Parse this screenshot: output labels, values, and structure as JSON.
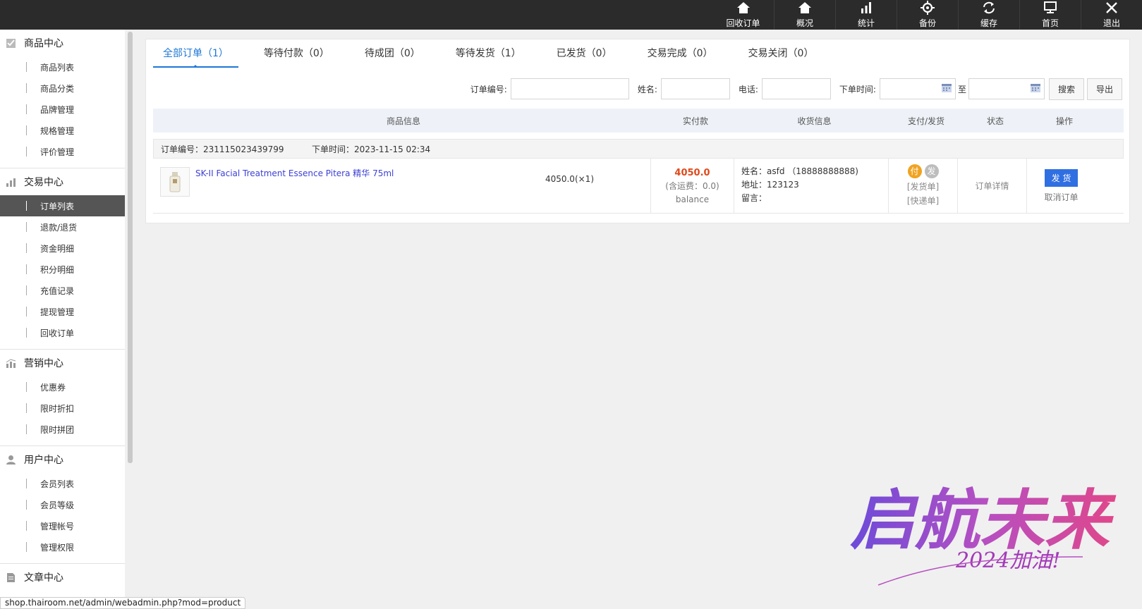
{
  "topnav": [
    {
      "label": "回收订单",
      "icon": "home-icon"
    },
    {
      "label": "概况",
      "icon": "home-icon"
    },
    {
      "label": "统计",
      "icon": "bar-chart-icon"
    },
    {
      "label": "备份",
      "icon": "gear-icon"
    },
    {
      "label": "缓存",
      "icon": "refresh-icon"
    },
    {
      "label": "首页",
      "icon": "monitor-icon"
    },
    {
      "label": "退出",
      "icon": "close-icon"
    }
  ],
  "sidebar": [
    {
      "title": "商品中心",
      "icon": "checkbox-icon",
      "items": [
        "商品列表",
        "商品分类",
        "品牌管理",
        "规格管理",
        "评价管理"
      ]
    },
    {
      "title": "交易中心",
      "icon": "bar-chart-icon",
      "items": [
        "订单列表",
        "退款/退货",
        "资金明细",
        "积分明细",
        "充值记录",
        "提现管理",
        "回收订单"
      ]
    },
    {
      "title": "营销中心",
      "icon": "marketing-icon",
      "items": [
        "优惠券",
        "限时折扣",
        "限时拼团"
      ]
    },
    {
      "title": "用户中心",
      "icon": "user-icon",
      "items": [
        "会员列表",
        "会员等级",
        "管理帐号",
        "管理权限"
      ]
    },
    {
      "title": "文章中心",
      "icon": "document-icon",
      "items": []
    }
  ],
  "active_item": "订单列表",
  "tabs": [
    {
      "label": "全部订单（1）",
      "active": true
    },
    {
      "label": "等待付款（0）",
      "active": false
    },
    {
      "label": "待成团（0）",
      "active": false
    },
    {
      "label": "等待发货（1）",
      "active": false
    },
    {
      "label": "已发货（0）",
      "active": false
    },
    {
      "label": "交易完成（0）",
      "active": false
    },
    {
      "label": "交易关闭（0）",
      "active": false
    }
  ],
  "search": {
    "order_no_label": "订单编号:",
    "name_label": "姓名:",
    "phone_label": "电话:",
    "time_label": "下单时间:",
    "to_label": "至",
    "search_btn": "搜索",
    "export_btn": "导出"
  },
  "table_headers": [
    "商品信息",
    "实付款",
    "收货信息",
    "支付/发货",
    "状态",
    "操作"
  ],
  "order": {
    "order_no": "订单编号：231115023439799",
    "order_time": "下单时间：2023-11-15 02:34",
    "product_name": "SK-II Facial Treatment Essence Pitera 精华 75ml",
    "qty_price": "4050.0(×1)",
    "paid": "4050.0",
    "shipping_fee": "(含运费：0.0)",
    "pay_method": "balance",
    "recv_name": "姓名：asfd （18888888888)",
    "recv_addr": "地址：123123",
    "recv_note": "留言：",
    "pay_badge": "付",
    "ship_badge": "发",
    "ship_slip": "[发货单]",
    "express_slip": "[快递单]",
    "status": "订单详情",
    "ship_btn": "发 货",
    "cancel": "取消订单"
  },
  "status_bar": "shop.thairoom.net/admin/webadmin.php?mod=product",
  "watermark": {
    "main": "启航未来",
    "sub": "2024加油!"
  },
  "colors": {
    "accent": "#1e78d6",
    "price": "#e0491a",
    "ship_button": "#2f6fe2",
    "pay_badge": "#f0a321",
    "ship_badge": "#bdbdbd"
  }
}
